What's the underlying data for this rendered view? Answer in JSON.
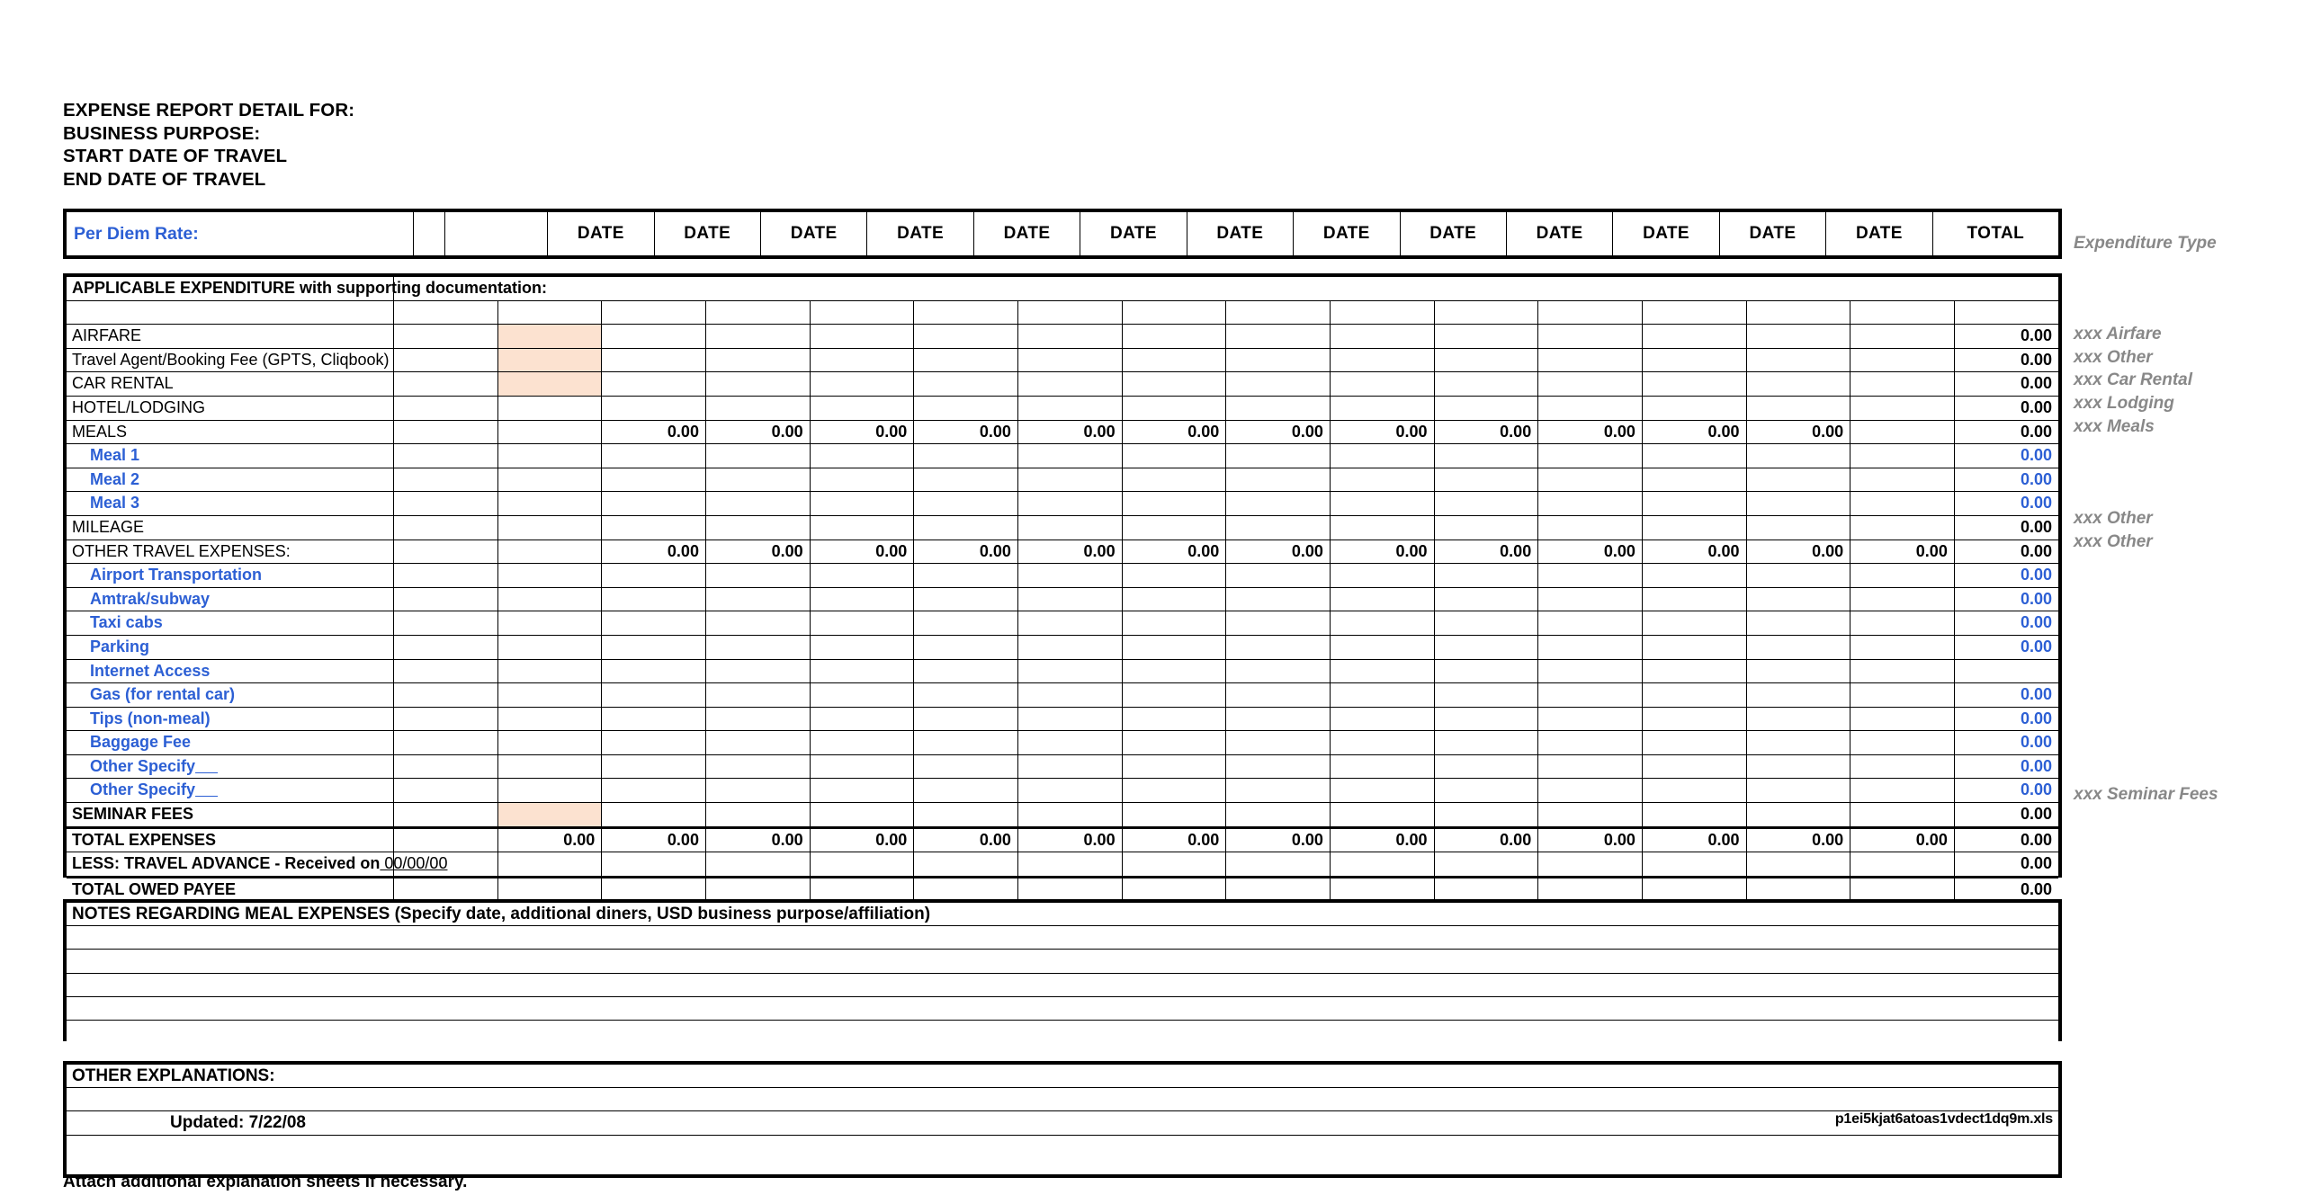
{
  "document": {
    "title_lines": [
      "EXPENSE REPORT DETAIL FOR:",
      "BUSINESS PURPOSE:",
      "START DATE OF TRAVEL",
      "END DATE OF TRAVEL"
    ],
    "attach_note": "Attach additional explanation sheets if necessary.",
    "updated_label": "Updated:  7/22/08",
    "filename": "p1ei5kjat6atoas1vdect1dq9m.xls"
  },
  "header": {
    "per_diem_label": "Per Diem Rate:",
    "per_diem_value": "",
    "date_columns": [
      "DATE",
      "DATE",
      "DATE",
      "DATE",
      "DATE",
      "DATE",
      "DATE",
      "DATE",
      "DATE",
      "DATE",
      "DATE",
      "DATE",
      "DATE"
    ],
    "total_column": "TOTAL",
    "expenditure_type_header": "Expenditure Type"
  },
  "section": {
    "applicable_expenditure": "APPLICABLE EXPENDITURE with supporting documentation:"
  },
  "rows": [
    {
      "label": "AIRFARE",
      "style": "major",
      "receipt": "peach",
      "dates": [
        "",
        "",
        "",
        "",
        "",
        "",
        "",
        "",
        "",
        "",
        "",
        "",
        ""
      ],
      "dates_fill": "dots",
      "total": "0.00",
      "total_style": "bold",
      "exp_type": "xxx Airfare"
    },
    {
      "label": "Travel Agent/Booking Fee (GPTS, Cliqbook)",
      "style": "major",
      "receipt": "peach",
      "dates": [
        "",
        "",
        "",
        "",
        "",
        "",
        "",
        "",
        "",
        "",
        "",
        "",
        ""
      ],
      "dates_fill": "dots",
      "total": "0.00",
      "total_style": "bold",
      "exp_type": "xxx Other"
    },
    {
      "label": "CAR RENTAL",
      "style": "major",
      "receipt": "peach",
      "dates": [
        "",
        "",
        "",
        "",
        "",
        "",
        "",
        "",
        "",
        "",
        "",
        "",
        ""
      ],
      "dates_fill": "dots",
      "total": "0.00",
      "total_style": "bold",
      "exp_type": "xxx Car Rental"
    },
    {
      "label": "HOTEL/LODGING",
      "style": "major",
      "receipt": "dots",
      "dates": [
        "",
        "",
        "",
        "",
        "",
        "",
        "",
        "",
        "",
        "",
        "",
        "",
        ""
      ],
      "dates_fill": "plain",
      "total": "0.00",
      "total_style": "bold",
      "exp_type": "xxx Lodging"
    },
    {
      "label": "MEALS",
      "style": "major",
      "receipt": "dots",
      "dates": [
        "0.00",
        "0.00",
        "0.00",
        "0.00",
        "0.00",
        "0.00",
        "0.00",
        "0.00",
        "0.00",
        "0.00",
        "0.00",
        "0.00",
        ""
      ],
      "dates_fill": "plain",
      "total": "0.00",
      "total_style": "bold",
      "exp_type": "xxx Meals"
    },
    {
      "label": "Meal 1",
      "style": "sub",
      "receipt": "dots",
      "dates": [
        "",
        "",
        "",
        "",
        "",
        "",
        "",
        "",
        "",
        "",
        "",
        "",
        ""
      ],
      "dates_fill": "plain",
      "total": "0.00",
      "total_style": "blue",
      "exp_type": ""
    },
    {
      "label": "Meal 2",
      "style": "sub",
      "receipt": "dots",
      "dates": [
        "",
        "",
        "",
        "",
        "",
        "",
        "",
        "",
        "",
        "",
        "",
        "",
        ""
      ],
      "dates_fill": "plain",
      "total": "0.00",
      "total_style": "blue",
      "exp_type": ""
    },
    {
      "label": "Meal 3",
      "style": "sub",
      "receipt": "dots",
      "dates": [
        "",
        "",
        "",
        "",
        "",
        "",
        "",
        "",
        "",
        "",
        "",
        "",
        ""
      ],
      "dates_fill": "plain",
      "total": "0.00",
      "total_style": "blue",
      "exp_type": ""
    },
    {
      "label": "MILEAGE",
      "style": "major",
      "receipt": "dots",
      "dates": [
        "",
        "",
        "",
        "",
        "",
        "",
        "",
        "",
        "",
        "",
        "",
        "",
        ""
      ],
      "dates_fill": "plain",
      "total": "0.00",
      "total_style": "bold",
      "exp_type": "xxx Other"
    },
    {
      "label": "OTHER TRAVEL EXPENSES:",
      "style": "major",
      "receipt": "dots",
      "dates": [
        "0.00",
        "0.00",
        "0.00",
        "0.00",
        "0.00",
        "0.00",
        "0.00",
        "0.00",
        "0.00",
        "0.00",
        "0.00",
        "0.00",
        "0.00"
      ],
      "dates_fill": "plain",
      "total": "0.00",
      "total_style": "bold",
      "exp_type": "xxx Other"
    },
    {
      "label": "Airport Transportation",
      "style": "sub",
      "receipt": "dots",
      "dates": [
        "",
        "",
        "",
        "",
        "",
        "",
        "",
        "",
        "",
        "",
        "",
        "",
        ""
      ],
      "dates_fill": "plain",
      "total": "0.00",
      "total_style": "blue",
      "exp_type": ""
    },
    {
      "label": "Amtrak/subway",
      "style": "sub",
      "receipt": "dots",
      "dates": [
        "",
        "",
        "",
        "",
        "",
        "",
        "",
        "",
        "",
        "",
        "",
        "",
        ""
      ],
      "dates_fill": "plain",
      "total": "0.00",
      "total_style": "blue",
      "exp_type": ""
    },
    {
      "label": "Taxi cabs",
      "style": "sub",
      "receipt": "dots",
      "dates": [
        "",
        "",
        "",
        "",
        "",
        "",
        "",
        "",
        "",
        "",
        "",
        "",
        ""
      ],
      "dates_fill": "plain",
      "total": "0.00",
      "total_style": "blue",
      "exp_type": ""
    },
    {
      "label": "Parking",
      "style": "sub",
      "receipt": "dots",
      "dates": [
        "",
        "",
        "",
        "",
        "",
        "",
        "",
        "",
        "",
        "",
        "",
        "",
        ""
      ],
      "dates_fill": "plain",
      "total": "0.00",
      "total_style": "blue",
      "exp_type": ""
    },
    {
      "label": "Internet Access",
      "style": "sub",
      "receipt": "dots",
      "dates": [
        "",
        "",
        "",
        "",
        "",
        "",
        "",
        "",
        "",
        "",
        "",
        "",
        ""
      ],
      "dates_fill": "plain",
      "total": "",
      "total_style": "blue",
      "exp_type": ""
    },
    {
      "label": "Gas (for rental car)",
      "style": "sub",
      "receipt": "dots",
      "dates": [
        "",
        "",
        "",
        "",
        "",
        "",
        "",
        "",
        "",
        "",
        "",
        "",
        ""
      ],
      "dates_fill": "plain",
      "total": "0.00",
      "total_style": "blue",
      "exp_type": ""
    },
    {
      "label": "Tips (non-meal)",
      "style": "sub",
      "receipt": "dots",
      "dates": [
        "",
        "",
        "",
        "",
        "",
        "",
        "",
        "",
        "",
        "",
        "",
        "",
        ""
      ],
      "dates_fill": "plain",
      "total": "0.00",
      "total_style": "blue",
      "exp_type": ""
    },
    {
      "label": "Baggage Fee",
      "style": "sub",
      "receipt": "dots",
      "dates": [
        "",
        "",
        "",
        "",
        "",
        "",
        "",
        "",
        "",
        "",
        "",
        "",
        ""
      ],
      "dates_fill": "plain",
      "total": "0.00",
      "total_style": "blue",
      "exp_type": ""
    },
    {
      "label": "Other   Specify",
      "style": "sub-uline",
      "receipt": "dots",
      "dates": [
        "",
        "",
        "",
        "",
        "",
        "",
        "",
        "",
        "",
        "",
        "",
        "",
        ""
      ],
      "dates_fill": "plain",
      "total": "0.00",
      "total_style": "blue",
      "exp_type": ""
    },
    {
      "label": "Other   Specify",
      "style": "sub-uline",
      "receipt": "dots",
      "dates": [
        "",
        "",
        "",
        "",
        "",
        "",
        "",
        "",
        "",
        "",
        "",
        "",
        ""
      ],
      "dates_fill": "plain",
      "total": "0.00",
      "total_style": "blue",
      "exp_type": ""
    },
    {
      "label": "SEMINAR FEES",
      "style": "bold",
      "receipt": "peach",
      "dates": [
        "",
        "",
        "",
        "",
        "",
        "",
        "",
        "",
        "",
        "",
        "",
        "",
        ""
      ],
      "dates_fill": "plain",
      "total": "0.00",
      "total_style": "bold",
      "exp_type": "xxx Seminar Fees"
    }
  ],
  "totals": {
    "total_expenses_label": "TOTAL EXPENSES",
    "total_expenses_receipt": "0.00",
    "total_expenses_dates": [
      "0.00",
      "0.00",
      "0.00",
      "0.00",
      "0.00",
      "0.00",
      "0.00",
      "0.00",
      "0.00",
      "0.00",
      "0.00",
      "0.00",
      "0.00"
    ],
    "total_expenses_total": "0.00",
    "travel_advance_label": "LESS:  TRAVEL ADVANCE - Received on",
    "travel_advance_date": "00/00/00",
    "travel_advance_total": "0.00",
    "total_owed_label": "TOTAL OWED PAYEE",
    "total_owed_total": "0.00"
  },
  "notes": {
    "header": "NOTES REGARDING MEAL EXPENSES (Specify date, additional diners, USD business purpose/affiliation)",
    "lines": [
      "",
      "",
      "",
      "",
      ""
    ]
  },
  "other_explanations": {
    "header": "OTHER EXPLANATIONS:",
    "lines": [
      "",
      "",
      ""
    ]
  }
}
